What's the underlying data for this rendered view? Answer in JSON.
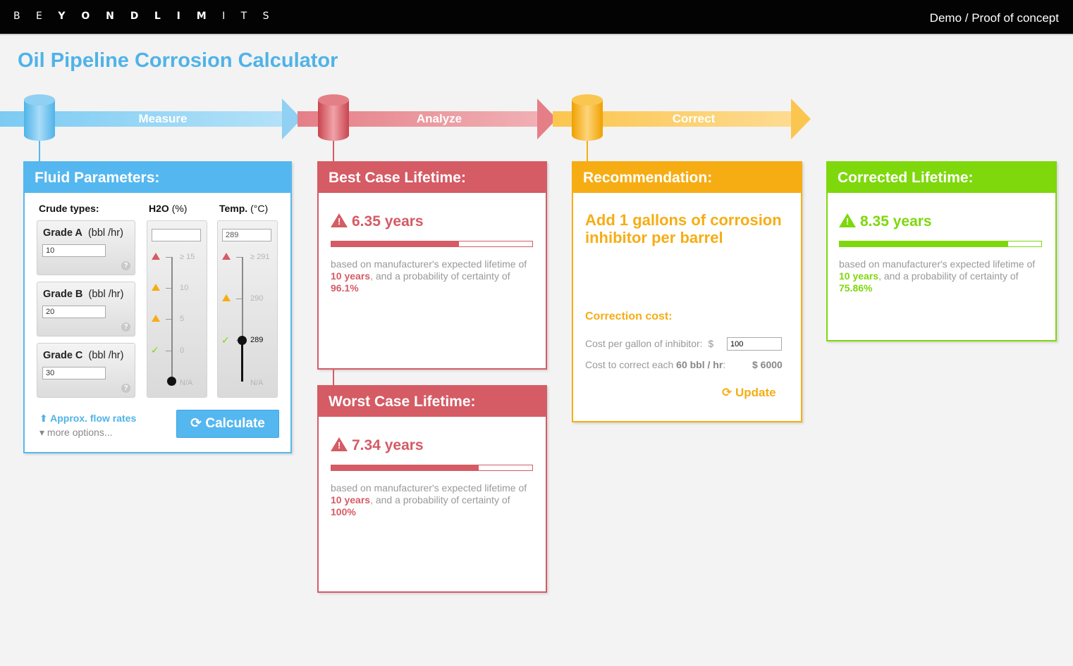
{
  "topbar": {
    "brand_parts": [
      "B E ",
      "Y O N D",
      " ",
      "L I M",
      " I T S"
    ],
    "subtitle": "Demo / Proof of concept"
  },
  "page_title": "Oil Pipeline Corrosion Calculator",
  "flow": {
    "measure": "Measure",
    "analyze": "Analyze",
    "correct": "Correct"
  },
  "fluid": {
    "title": "Fluid Parameters:",
    "col_crude": "Crude types:",
    "col_h2o": "H2O",
    "col_h2o_unit": "(%)",
    "col_temp": "Temp.",
    "col_temp_unit": "(°C)",
    "grades": [
      {
        "name": "Grade A",
        "unit": "(bbl /hr)",
        "value": "10"
      },
      {
        "name": "Grade B",
        "unit": "(bbl /hr)",
        "value": "20"
      },
      {
        "name": "Grade C",
        "unit": "(bbl /hr)",
        "value": "30"
      }
    ],
    "h2o_value": "",
    "h2o_ticks": [
      "≥ 15",
      "10",
      "5",
      "0",
      "N/A"
    ],
    "h2o_level": "N/A",
    "temp_value": "289",
    "temp_ticks": [
      "≥ 291",
      "290",
      "289",
      "N/A"
    ],
    "temp_level": "289",
    "approx_link": "Approx. flow rates",
    "more_options": "▾ more options...",
    "calculate": "Calculate"
  },
  "best": {
    "title": "Best Case Lifetime:",
    "value": "6.35 years",
    "fraction": 0.635,
    "desc_a": "based on manufacturer's expected lifetime of ",
    "desc_b": "10 years",
    "desc_c": ", and a probability of certainty of ",
    "desc_d": "96.1%"
  },
  "worst": {
    "title": "Worst Case Lifetime:",
    "value": "7.34 years",
    "fraction": 0.734,
    "desc_a": "based on manufacturer's expected lifetime of ",
    "desc_b": "10 years",
    "desc_c": ", and a probability of certainty of ",
    "desc_d": "100%"
  },
  "recommendation": {
    "title": "Recommendation:",
    "text": "Add 1 gallons of corrosion inhibitor per barrel",
    "cost_title": "Correction cost:",
    "cost_per_gallon_label": "Cost per gallon of inhibitor:",
    "currency": "$",
    "cost_per_gallon": "100",
    "cost_each_label": "Cost to correct each ",
    "cost_each_rate": "60 bbl / hr",
    "cost_each_colon": ":",
    "cost_each_value": "$ 6000",
    "update": "Update"
  },
  "corrected": {
    "title": "Corrected Lifetime:",
    "value": "8.35 years",
    "fraction": 0.835,
    "desc_a": "based on manufacturer's expected lifetime of ",
    "desc_b": "10 years",
    "desc_c": ", and a probability of certainty of ",
    "desc_d": "75.86%"
  },
  "colors": {
    "blue": "#55b7ef",
    "red": "#d55b64",
    "orange": "#f6ad14",
    "green": "#7ed80c"
  }
}
